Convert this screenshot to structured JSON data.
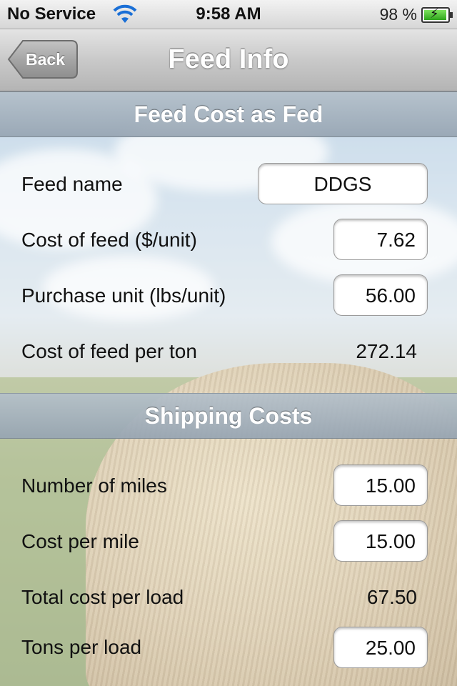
{
  "status_bar": {
    "carrier": "No Service",
    "time": "9:58 AM",
    "battery_percent": "98 %",
    "battery_level": 0.98,
    "icons": [
      "wifi-icon",
      "battery-charging-icon"
    ]
  },
  "nav": {
    "title": "Feed Info",
    "back_label": "Back"
  },
  "feed_cost": {
    "header": "Feed Cost as Fed",
    "feed_name_label": "Feed name",
    "feed_name_value": "DDGS",
    "cost_label": "Cost of feed ($/unit)",
    "cost_value": "7.62",
    "unit_label": "Purchase unit (lbs/unit)",
    "unit_value": "56.00",
    "per_ton_label": "Cost of feed per ton",
    "per_ton_value": "272.14"
  },
  "shipping": {
    "header": "Shipping Costs",
    "miles_label": "Number of miles",
    "miles_value": "15.00",
    "cost_mile_label": "Cost per mile",
    "cost_mile_value": "15.00",
    "total_load_label": "Total cost per load",
    "total_load_value": "67.50",
    "tons_label": "Tons per load",
    "tons_value": "25.00"
  }
}
